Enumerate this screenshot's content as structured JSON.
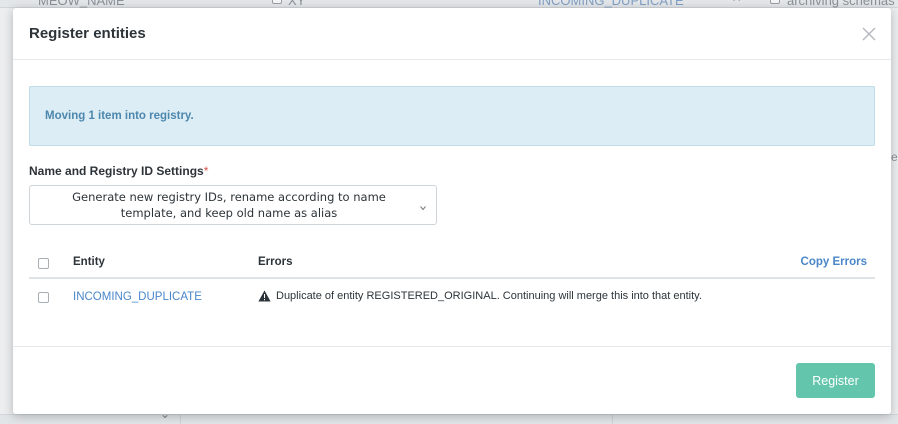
{
  "background": {
    "col1_text": "MEOW_NAME",
    "col2_text": "XY",
    "link_text": "INCOMING_DUPLICATE",
    "checkbox_label": "archiving schemas",
    "side_text": "es"
  },
  "modal": {
    "title": "Register entities",
    "notice": "Moving 1 item into registry.",
    "field_label": "Name and Registry ID Settings",
    "required_mark": "*",
    "select_value": "Generate new registry IDs, rename according to name template, and keep old name as alias",
    "table": {
      "headers": {
        "entity": "Entity",
        "errors": "Errors"
      },
      "copy_errors": "Copy Errors",
      "rows": [
        {
          "entity": "INCOMING_DUPLICATE",
          "error": "Duplicate of entity REGISTERED_ORIGINAL. Continuing will merge this into that entity."
        }
      ]
    },
    "register_button": "Register"
  },
  "colors": {
    "accent_link": "#4a86c9",
    "register_button": "#62c5ac",
    "notice_bg": "#dcedf5",
    "notice_text": "#4d87ad"
  }
}
